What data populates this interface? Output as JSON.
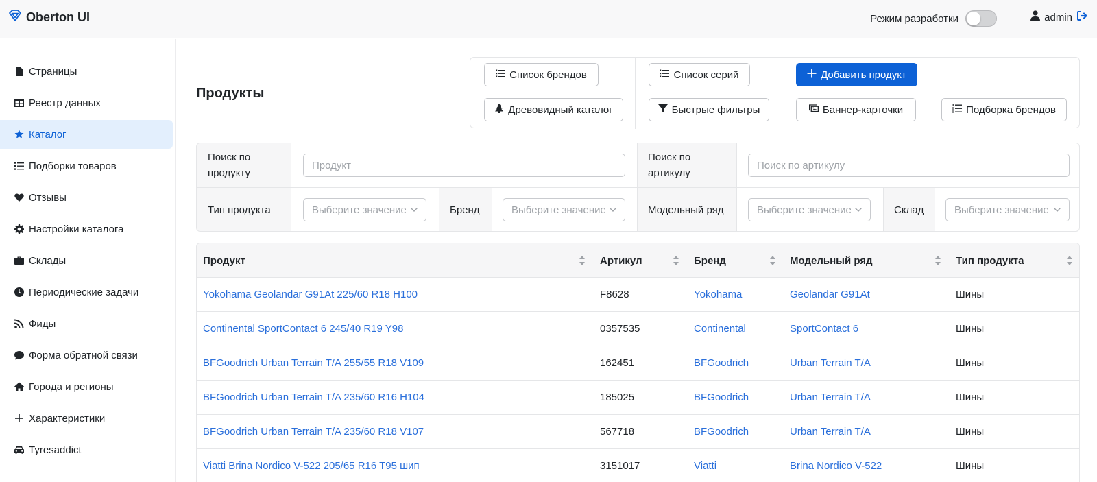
{
  "header": {
    "brand": "Oberton UI",
    "dev_mode_label": "Режим разработки",
    "user": "admin"
  },
  "sidebar": {
    "items": [
      {
        "label": "Страницы",
        "icon": "file-icon"
      },
      {
        "label": "Реестр данных",
        "icon": "table-icon"
      },
      {
        "label": "Каталог",
        "icon": "star-icon",
        "active": true
      },
      {
        "label": "Подборки товаров",
        "icon": "list-icon"
      },
      {
        "label": "Отзывы",
        "icon": "heart-icon"
      },
      {
        "label": "Настройки каталога",
        "icon": "gear-icon"
      },
      {
        "label": "Склады",
        "icon": "briefcase-icon"
      },
      {
        "label": "Периодические задачи",
        "icon": "clock-icon"
      },
      {
        "label": "Фиды",
        "icon": "rss-icon"
      },
      {
        "label": "Форма обратной связи",
        "icon": "chat-icon"
      },
      {
        "label": "Города и регионы",
        "icon": "home-icon"
      },
      {
        "label": "Характеристики",
        "icon": "plus-icon"
      },
      {
        "label": "Tyresaddict",
        "icon": "car-icon"
      }
    ]
  },
  "main": {
    "title": "Продукты",
    "actions": {
      "brands_list": "Список брендов",
      "series_list": "Список серий",
      "add_product": "Добавить продукт",
      "tree_catalog": "Древовидный каталог",
      "quick_filters": "Быстрые фильтры",
      "banner_cards": "Баннер-карточки",
      "brand_selection": "Подборка брендов"
    },
    "filters": {
      "product_label": "Поиск по продукту",
      "product_placeholder": "Продукт",
      "sku_label": "Поиск по артикулу",
      "sku_placeholder": "Поиск по артикулу",
      "type_label": "Тип продукта",
      "brand_label": "Бренд",
      "model_label": "Модельный ряд",
      "warehouse_label": "Склад",
      "select_placeholder": "Выберите значение"
    },
    "table": {
      "columns": [
        "Продукт",
        "Артикул",
        "Бренд",
        "Модельный ряд",
        "Тип продукта"
      ],
      "rows": [
        [
          "Yokohama Geolandar G91At 225/60 R18 H100",
          "F8628",
          "Yokohama",
          "Geolandar G91At",
          "Шины"
        ],
        [
          "Continental SportContact 6 245/40 R19 Y98",
          "0357535",
          "Continental",
          "SportContact 6",
          "Шины"
        ],
        [
          "BFGoodrich Urban Terrain T/A 255/55 R18 V109",
          "162451",
          "BFGoodrich",
          "Urban Terrain T/A",
          "Шины"
        ],
        [
          "BFGoodrich Urban Terrain T/A 235/60 R16 H104",
          "185025",
          "BFGoodrich",
          "Urban Terrain T/A",
          "Шины"
        ],
        [
          "BFGoodrich Urban Terrain T/A 235/60 R18 V107",
          "567718",
          "BFGoodrich",
          "Urban Terrain T/A",
          "Шины"
        ],
        [
          "Viatti Brina Nordico V-522 205/65 R16 T95 шип",
          "3151017",
          "Viatti",
          "Brina Nordico V-522",
          "Шины"
        ]
      ]
    }
  },
  "colors": {
    "accent": "#0d61d6",
    "link": "#2a6fdb",
    "active_bg": "#e3effd"
  }
}
